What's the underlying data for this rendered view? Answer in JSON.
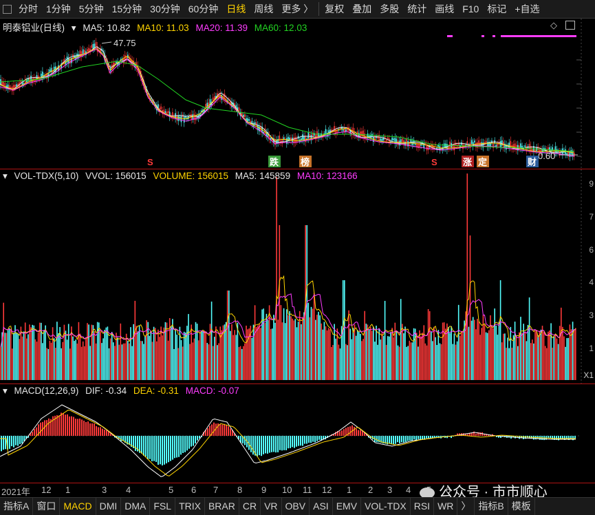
{
  "toolbar": {
    "periods": [
      "分时",
      "1分钟",
      "5分钟",
      "15分钟",
      "30分钟",
      "60分钟",
      "日线",
      "周线",
      "更多"
    ],
    "active_period": "日线",
    "more_arrow": "〉",
    "tools": [
      "复权",
      "叠加",
      "多股",
      "统计",
      "画线",
      "F10",
      "标记",
      "+自选"
    ]
  },
  "price_pane": {
    "title": "明泰铝业(日线)",
    "ma5": "MA5: 10.82",
    "ma10": "MA10: 11.03",
    "ma20": "MA20: 11.39",
    "ma60": "MA60: 12.03",
    "high_label": "47.75",
    "low_label": "0.60",
    "markers": [
      "S",
      "跌",
      "榜",
      "S",
      "涨",
      "定",
      "财"
    ]
  },
  "volume_pane": {
    "title": "VOL-TDX(5,10)",
    "vvol": "VVOL: 156015",
    "volume": "VOLUME: 156015",
    "ma5": "MA5: 145859",
    "ma10": "MA10: 123166",
    "axis_ticks": [
      "9",
      "7",
      "6",
      "4",
      "3",
      "1"
    ],
    "unit": "X1"
  },
  "macd_pane": {
    "title": "MACD(12,26,9)",
    "dif": "DIF: -0.34",
    "dea": "DEA: -0.31",
    "macd": "MACD: -0.07"
  },
  "time_axis": {
    "labels": [
      "2021年",
      "12",
      "1",
      "3",
      "4",
      "5",
      "6",
      "7",
      "8",
      "9",
      "10",
      "11",
      "12",
      "1",
      "2",
      "3",
      "4",
      "5",
      "6"
    ]
  },
  "bottom_tabs": {
    "items": [
      "指标A",
      "窗口",
      "MACD",
      "DMI",
      "DMA",
      "FSL",
      "TRIX",
      "BRAR",
      "CR",
      "VR",
      "OBV",
      "ASI",
      "EMV",
      "VOL-TDX",
      "RSI",
      "WR",
      "〉",
      "指标B",
      "模板"
    ],
    "active": "MACD"
  },
  "watermark": "公众号 · 市市顺心",
  "colors": {
    "up": "#ff3a3a",
    "down": "#54ffff",
    "ma5": "#e6e6e6",
    "ma10": "#ffd400",
    "ma20": "#ff3cff",
    "ma60": "#22d322",
    "separator": "#b01414"
  }
}
